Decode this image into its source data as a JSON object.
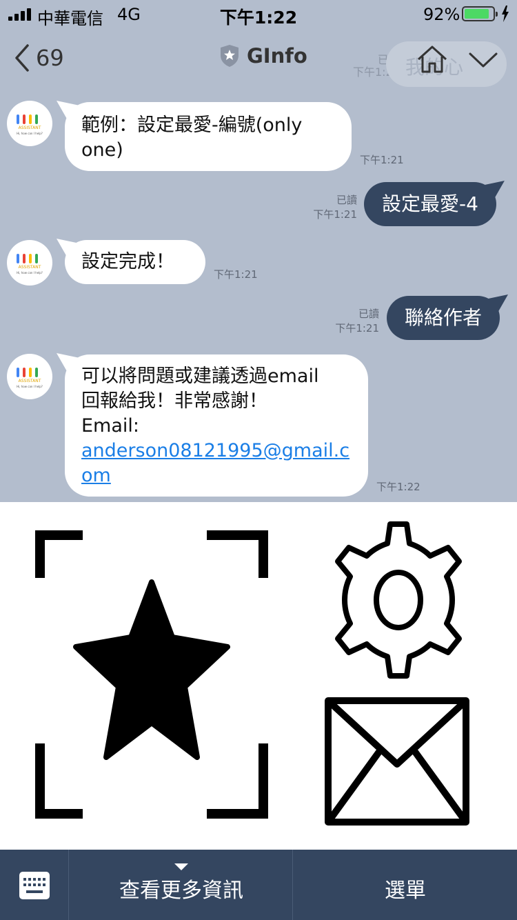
{
  "status_bar": {
    "carrier": "中華電信",
    "network": "4G",
    "time": "下午1:22",
    "battery_percent": "92%",
    "battery_level": 0.92
  },
  "nav": {
    "back_count": "69",
    "title": "GInfo",
    "ghost_read_label": "已讀",
    "ghost_time": "下午1:21",
    "ghost_bubble_text": "我的心"
  },
  "messages": [
    {
      "direction": "in",
      "text": "範例：設定最愛-編號(only one)",
      "time": "下午1:21"
    },
    {
      "direction": "out",
      "text": "設定最愛-4",
      "read_label": "已讀",
      "time": "下午1:21"
    },
    {
      "direction": "in",
      "text": "設定完成！",
      "time": "下午1:21"
    },
    {
      "direction": "out",
      "text": "聯絡作者",
      "read_label": "已讀",
      "time": "下午1:21"
    },
    {
      "direction": "in",
      "line1": "可以將問題或建議透過email",
      "line2": "回報給我！非常感謝！",
      "line3": "Email:",
      "link": "anderson08121995@gmail.com",
      "time": "下午1:22"
    }
  ],
  "avatar": {
    "label": "ASSISTANT",
    "sublabel": "Hi, how can I help?",
    "dot_colors": [
      "#4285f4",
      "#ea4335",
      "#fbbc05",
      "#34a853"
    ]
  },
  "rich_menu": {
    "icons": [
      "favorite-star-icon",
      "settings-gear-icon",
      "mail-envelope-icon"
    ]
  },
  "bottom_bar": {
    "more_info_label": "查看更多資訊",
    "menu_label": "選單"
  },
  "colors": {
    "chat_background": "#b3bdcd",
    "outgoing_bubble": "#344660",
    "link": "#1a7ee6",
    "battery_fill": "#4cd964"
  }
}
